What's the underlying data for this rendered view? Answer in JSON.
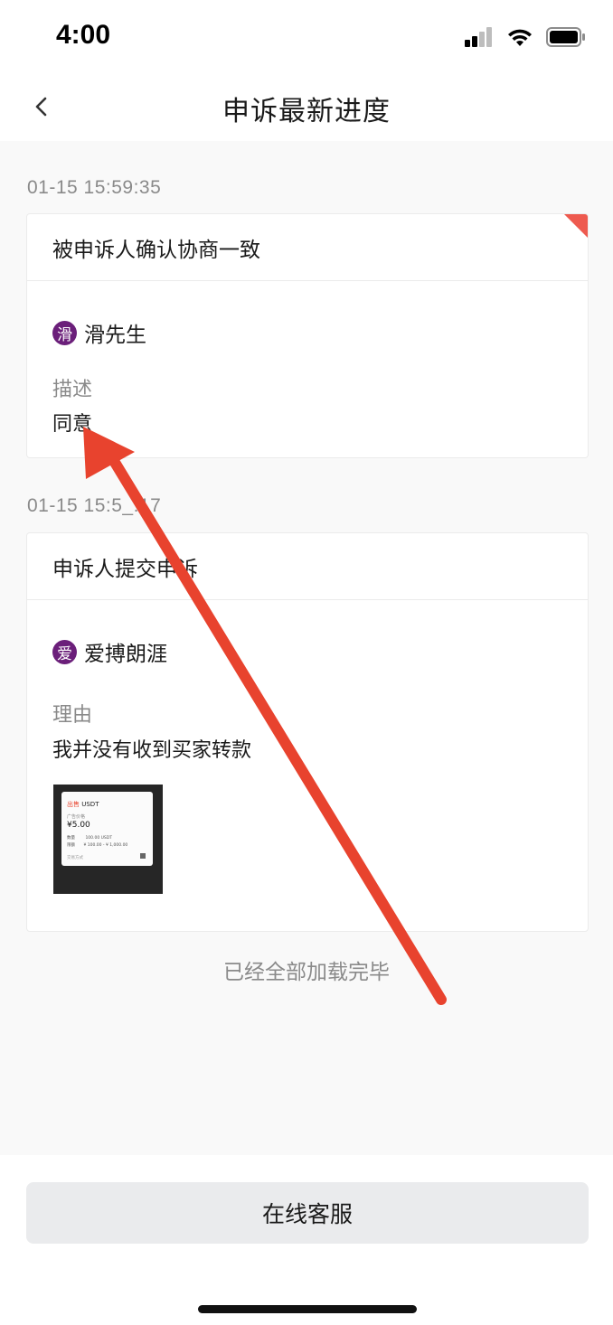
{
  "status_bar": {
    "time": "4:00"
  },
  "header": {
    "title": "申诉最新进度"
  },
  "entries": [
    {
      "timestamp": "01-15 15:59:35",
      "title": "被申诉人确认协商一致",
      "user": {
        "avatar_char": "滑",
        "name": "滑先生"
      },
      "field_label": "描述",
      "field_value": "同意"
    },
    {
      "timestamp": "01-15 15:5_:17",
      "title": "申诉人提交申诉",
      "user": {
        "avatar_char": "爱",
        "name": "爱搏朗涯"
      },
      "field_label": "理由",
      "field_value": "我并没有收到买家转款",
      "attachment": {
        "sell_label": "出售",
        "coin": "USDT",
        "price_label": "广告价格",
        "price": "¥5.00",
        "qty_label": "数量",
        "qty": "100.00 USDT",
        "limit_label": "限额",
        "limit": "¥ 100.00 - ¥ 1,000.00",
        "payment_label": "交易方式"
      }
    }
  ],
  "list_end_text": "已经全部加载完毕",
  "support_button_label": "在线客服",
  "colors": {
    "avatar": "#6b1f7a",
    "corner_flag": "#ee5a4f",
    "annotation_arrow": "#e8432e",
    "button_bg": "#eaebed"
  }
}
